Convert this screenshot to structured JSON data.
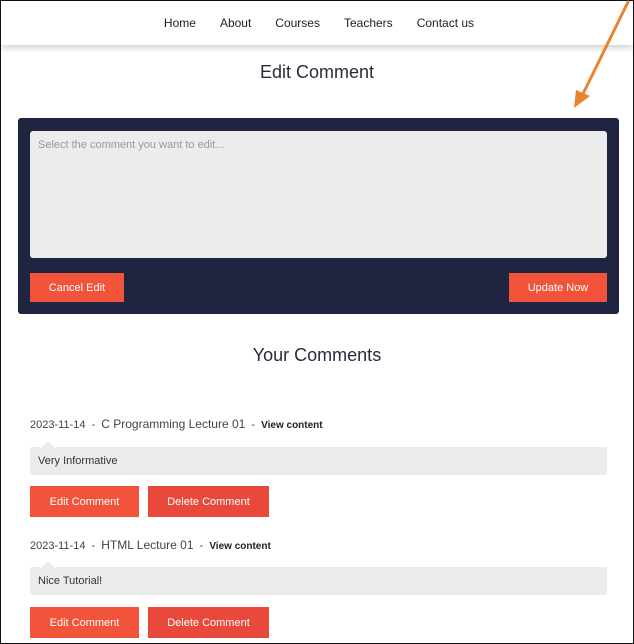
{
  "nav": {
    "items": [
      "Home",
      "About",
      "Courses",
      "Teachers",
      "Contact us"
    ]
  },
  "page": {
    "title": "Edit Comment"
  },
  "edit_form": {
    "placeholder": "Select the comment you want to edit...",
    "cancel_label": "Cancel Edit",
    "update_label": "Update Now"
  },
  "comments_section": {
    "title": "Your Comments",
    "view_label": "View content",
    "edit_label": "Edit Comment",
    "delete_label": "Delete Comment",
    "separator": "-",
    "comments": [
      {
        "date": "2023-11-14",
        "lecture": "C Programming Lecture 01",
        "text": "Very Informative"
      },
      {
        "date": "2023-11-14",
        "lecture": "HTML Lecture 01",
        "text": "Nice Tutorial!"
      }
    ]
  },
  "colors": {
    "accent": "#f1533b",
    "panel": "#1f2540",
    "arrow": "#e8832e"
  }
}
